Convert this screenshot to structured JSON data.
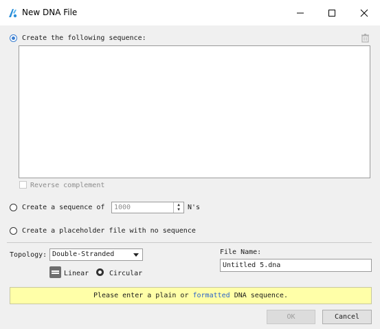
{
  "window": {
    "title": "New DNA File",
    "minimize_glyph": "—",
    "maximize_glyph": "☐",
    "close_glyph": "✕"
  },
  "options": {
    "create_sequence": "Create the following sequence:",
    "reverse_complement": "Reverse complement",
    "create_ns_prefix": "Create a sequence of",
    "ns_count": "1000",
    "ns_suffix": "N's",
    "placeholder": "Create a placeholder file with no sequence"
  },
  "topology": {
    "label": "Topology:",
    "value": "Double-Stranded",
    "linear": "Linear",
    "circular": "Circular"
  },
  "file": {
    "label": "File Name:",
    "value": "Untitled 5.dna"
  },
  "message": {
    "before": "Please enter a plain or ",
    "link": "formatted",
    "after": " DNA sequence."
  },
  "buttons": {
    "ok": "OK",
    "cancel": "Cancel"
  },
  "colors": {
    "accent": "#3c7fd0",
    "message_bg": "#ffffa8",
    "link": "#2a62c9"
  }
}
